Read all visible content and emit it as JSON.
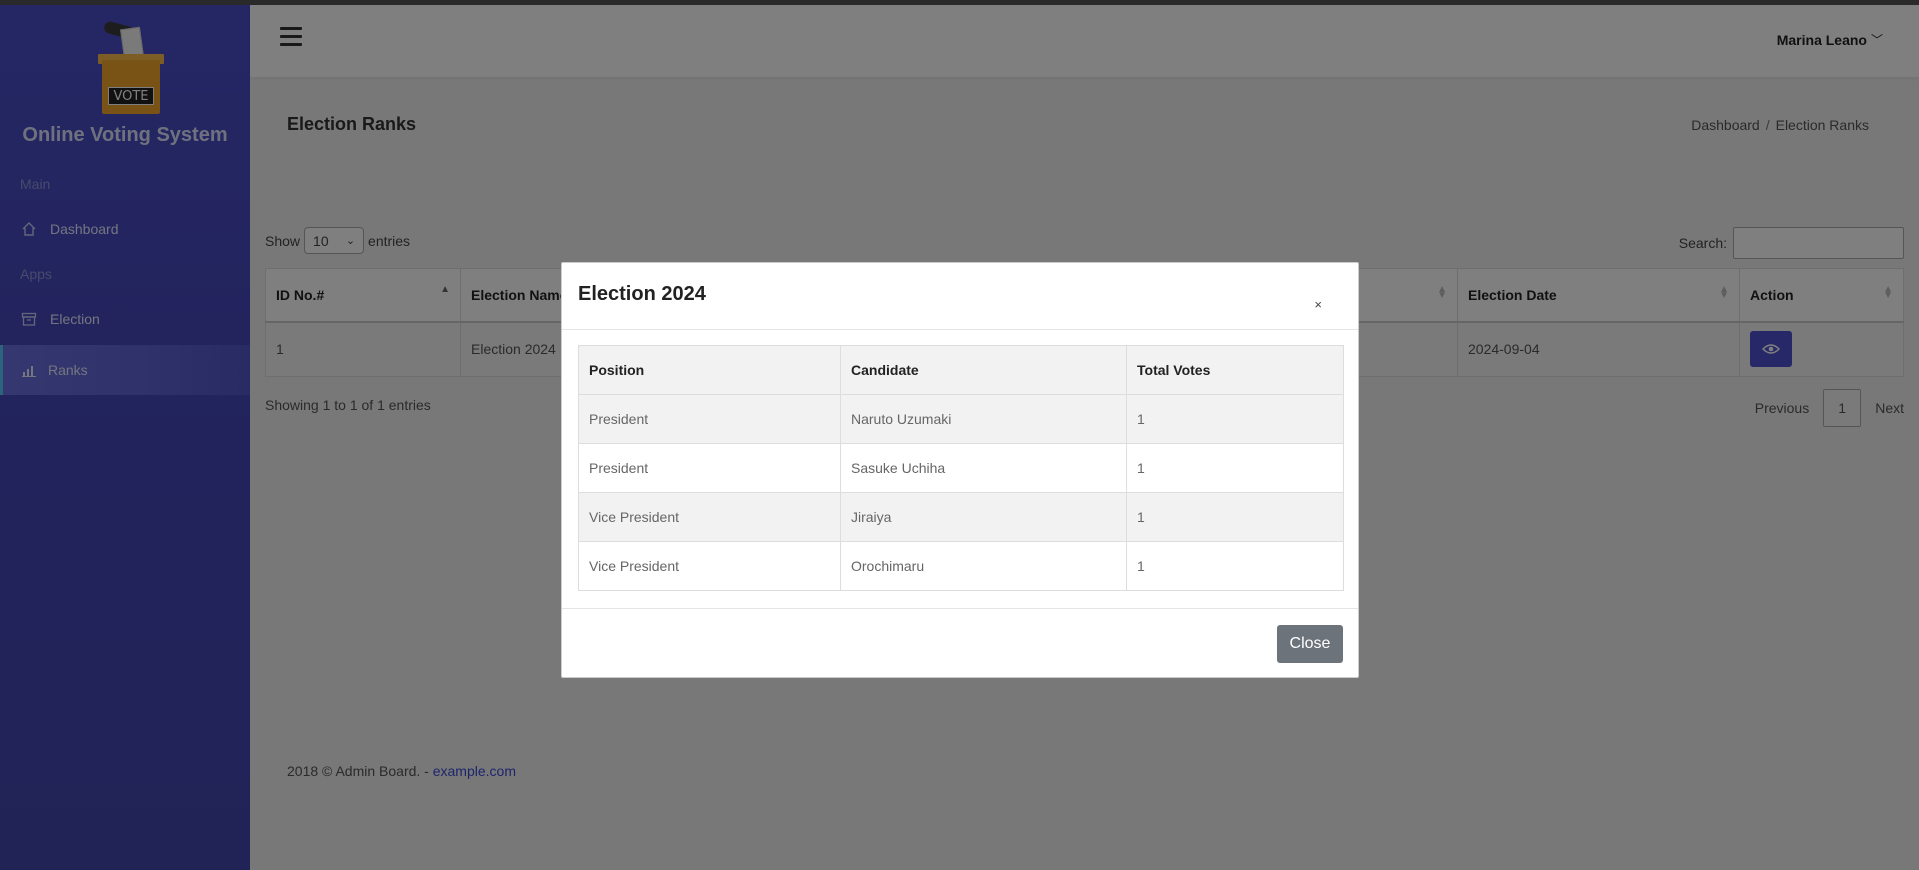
{
  "sidebar": {
    "brand_logo_text": "VOTE",
    "brand_title": "Online Voting System",
    "section_main": "Main",
    "section_apps": "Apps",
    "items": [
      {
        "label": "Dashboard",
        "icon": "home-icon"
      },
      {
        "label": "Election",
        "icon": "archive-box-icon"
      },
      {
        "label": "Ranks",
        "icon": "bar-chart-icon"
      }
    ]
  },
  "header": {
    "user_name": "Marina Leano"
  },
  "page": {
    "title": "Election Ranks",
    "breadcrumb": [
      "Dashboard",
      "Election Ranks"
    ]
  },
  "table_controls": {
    "show_label": "Show",
    "entries_value": "10",
    "entries_label": "entries",
    "search_label": "Search:",
    "search_value": ""
  },
  "table": {
    "columns": [
      "ID No.#",
      "Election Name",
      "Election Date",
      "Action"
    ],
    "rows": [
      {
        "id": "1",
        "name": "Election 2024",
        "date": "2024-09-04"
      }
    ]
  },
  "pagination": {
    "info": "Showing 1 to 1 of 1 entries",
    "previous": "Previous",
    "current": "1",
    "next": "Next"
  },
  "footer": {
    "text": "2018 © Admin Board. - ",
    "link": "example.com"
  },
  "modal": {
    "title": "Election 2024",
    "close_x": "×",
    "columns": [
      "Position",
      "Candidate",
      "Total Votes"
    ],
    "rows": [
      {
        "position": "President",
        "candidate": "Naruto Uzumaki",
        "votes": "1"
      },
      {
        "position": "President",
        "candidate": "Sasuke Uchiha",
        "votes": "1"
      },
      {
        "position": "Vice President",
        "candidate": "Jiraiya",
        "votes": "1"
      },
      {
        "position": "Vice President",
        "candidate": "Orochimaru",
        "votes": "1"
      }
    ],
    "close_button": "Close"
  },
  "colors": {
    "sidebar": "#4547b9",
    "accent": "#4c51d1",
    "close_button": "#6c737b"
  }
}
